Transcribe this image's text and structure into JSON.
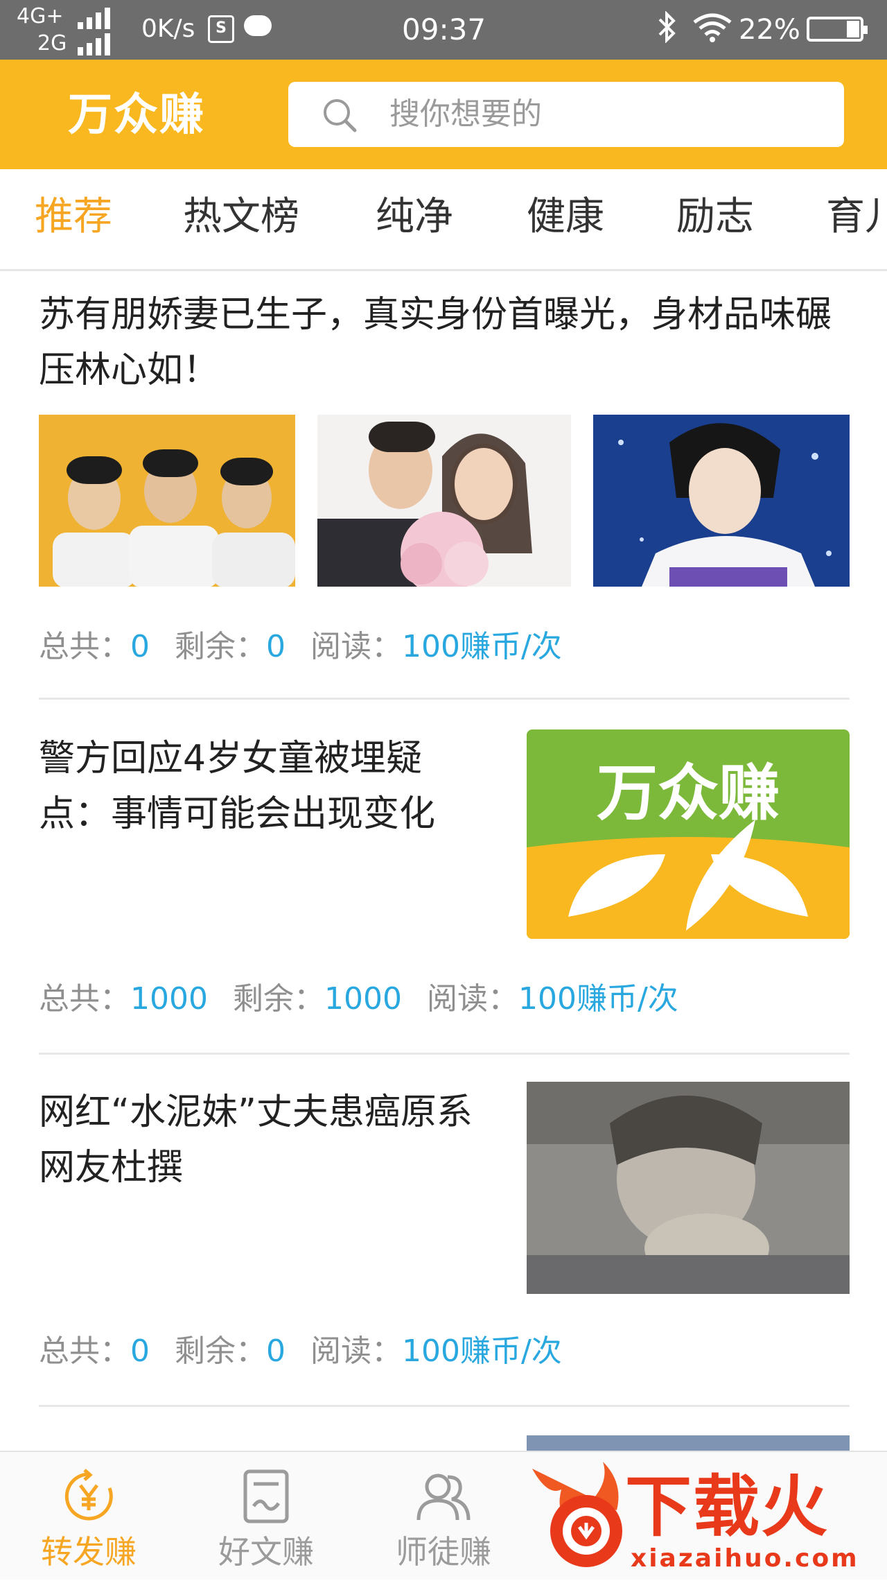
{
  "status_bar": {
    "network_top": "4G+",
    "network_bottom": "2G",
    "speed": "0K/s",
    "sim_icon": "S",
    "time": "09:37",
    "battery": "22%"
  },
  "header": {
    "logo": "万众赚",
    "search_placeholder": "搜你想要的"
  },
  "tabs": [
    "推荐",
    "热文榜",
    "纯净",
    "健康",
    "励志",
    "育儿"
  ],
  "articles": [
    {
      "title": "苏有朋娇妻已生子，真实身份首曝光，身材品味碾压林心如！",
      "meta": {
        "total_label": "总共：",
        "total": "0",
        "remain_label": "剩余：",
        "remain": "0",
        "read_label": "阅读：",
        "read": "100赚币/次"
      }
    },
    {
      "title": "警方回应4岁女童被埋疑点：事情可能会出现变化",
      "image_logo": "万众赚",
      "meta": {
        "total_label": "总共：",
        "total": "1000",
        "remain_label": "剩余：",
        "remain": "1000",
        "read_label": "阅读：",
        "read": "100赚币/次"
      }
    },
    {
      "title": "网红“水泥妹”丈夫患癌原系网友杜撰",
      "meta": {
        "total_label": "总共：",
        "total": "0",
        "remain_label": "剩余：",
        "remain": "0",
        "read_label": "阅读：",
        "read": "100赚币/次"
      }
    }
  ],
  "bottom_nav": [
    {
      "label": "转发赚",
      "icon": "yuan-refresh-icon",
      "active": true
    },
    {
      "label": "好文赚",
      "icon": "document-icon",
      "active": false
    },
    {
      "label": "师徒赚",
      "icon": "users-icon",
      "active": false
    }
  ],
  "watermark": {
    "brand": "下载火",
    "url": "xiazaihuo.com"
  },
  "colors": {
    "brand_yellow": "#f9b81f",
    "accent_orange": "#f6a623",
    "value_blue": "#29a8e0",
    "logo_green": "#7cb93a"
  }
}
